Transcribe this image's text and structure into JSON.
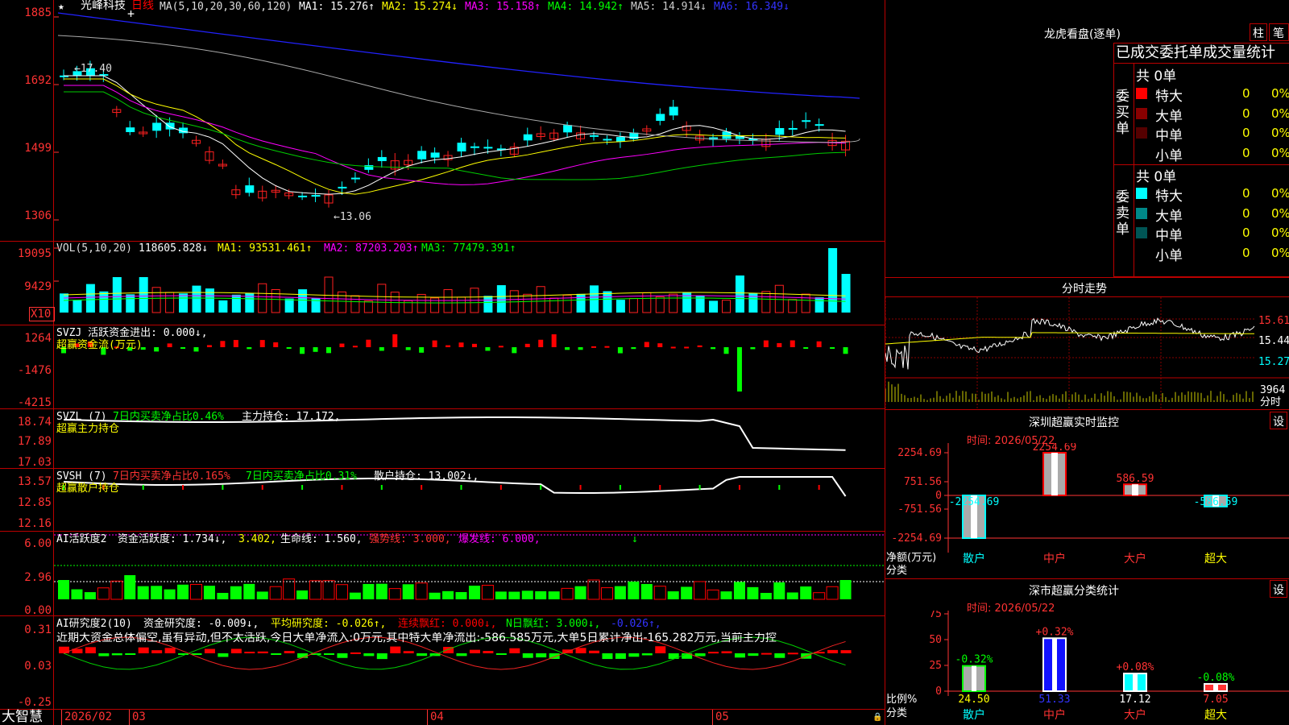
{
  "main": {
    "yticks": [
      "1885",
      "1692",
      "1499",
      "1306"
    ],
    "title": "光峰科技",
    "period": "日线",
    "ma_head": "MA(5,10,20,30,60,120)",
    "mas": [
      {
        "label": "MA1: 15.276↑",
        "color": "#ffffff"
      },
      {
        "label": "MA2: 15.274↓",
        "color": "#ffff00"
      },
      {
        "label": "MA3: 15.158↑",
        "color": "#ff00ff"
      },
      {
        "label": "MA4: 14.942↑",
        "color": "#00ff00"
      },
      {
        "label": "MA5: 14.914↓",
        "color": "#cccccc"
      },
      {
        "label": "MA6: 16.349↓",
        "color": "#3333ff"
      }
    ],
    "high_note": "←17.40",
    "low_note": "←13.06",
    "star": "★",
    "cursor": "+"
  },
  "vol": {
    "yticks": [
      "19095",
      "9429"
    ],
    "unit": "X10",
    "head": "VOL(5,10,20)",
    "items": [
      {
        "label": "118605.828↓",
        "color": "#ffffff"
      },
      {
        "label": "MA1: 93531.461↑",
        "color": "#ffff00"
      },
      {
        "label": "MA2: 87203.203↑",
        "color": "#ff00ff"
      },
      {
        "label": "MA3: 77479.391↑",
        "color": "#00ff00"
      }
    ]
  },
  "svzj": {
    "yticks": [
      "1264",
      "-1476",
      "-4215"
    ],
    "line1": "SVZJ  活跃资金进出: 0.000↓,",
    "line2": "超赢资金流(万元)"
  },
  "svzl": {
    "yticks": [
      "18.74",
      "17.89",
      "17.03"
    ],
    "a": "SVZL (7)",
    "b": "7日内买卖净占比0.46%",
    "c": "主力持仓: 17.172,",
    "line2": "超赢主力持仓"
  },
  "svsh": {
    "yticks": [
      "13.57",
      "12.85",
      "12.16"
    ],
    "a": "SVSH (7)",
    "b": "7日内买卖净占比0.165%",
    "c": "7日内买卖净占比0.31%",
    "d": "散户持仓: 13.002↓,",
    "line2": "超赢散户持仓"
  },
  "ai": {
    "yticks": [
      "6.00",
      "2.96",
      "0.00"
    ],
    "a": "AI活跃度2",
    "b": "资金活跃度: 1.734↓,",
    "c": "3.402,",
    "d": "生命线: 1.560,",
    "e": "强势线: 3.000,",
    "f": "爆发线: 6.000,",
    "arrow": "↓"
  },
  "research": {
    "yticks": [
      "0.31",
      "0.03",
      "-0.25"
    ],
    "a": "AI研究度2(10)",
    "b": "资金研究度: -0.009↓,",
    "c": "平均研究度: -0.026↑,",
    "d": "连续飘红: 0.000↓,",
    "e": "N日飘红: 3.000↓,",
    "f": "-0.026↑,",
    "note": "近期大资金总体偏空,虽有异动,但不太活跃,今日大单净流入:0万元,其中特大单净流出:-586.585万元,大单5日累计净出-165.282万元,当前主力控"
  },
  "bottom": {
    "brand": "大智慧",
    "dates": [
      "2026/02",
      "03",
      "04",
      "05"
    ],
    "lock": "🔒"
  },
  "right": {
    "dragon_title": "龙虎看盘(逐单)",
    "btn_zhu": "柱",
    "btn_bi": "笔",
    "stats_header": "已成交委托单成交量统计",
    "buy_label": "委买单",
    "sell_label": "委卖单",
    "buy_total": "共 0单",
    "sell_total": "共 0单",
    "buy_rows": [
      {
        "name": "特大",
        "val": "0",
        "pct": "0%",
        "color": "#ff0000"
      },
      {
        "name": "大单",
        "val": "0",
        "pct": "0%",
        "color": "#880000"
      },
      {
        "name": "中单",
        "val": "0",
        "pct": "0%",
        "color": "#550000"
      },
      {
        "name": "小单",
        "val": "0",
        "pct": "0%",
        "color": ""
      }
    ],
    "sell_rows": [
      {
        "name": "特大",
        "val": "0",
        "pct": "0%",
        "color": "#00ffff"
      },
      {
        "name": "大单",
        "val": "0",
        "pct": "0%",
        "color": "#008888"
      },
      {
        "name": "中单",
        "val": "0",
        "pct": "0%",
        "color": "#005555"
      },
      {
        "name": "小单",
        "val": "0",
        "pct": "0%",
        "color": ""
      }
    ],
    "intraday_title": "分时走势",
    "intraday_y": [
      "15.61",
      "15.44",
      "15.27"
    ],
    "intraday_vol": "3964",
    "intraday_vol_unit": "分时",
    "monitor_title": "深圳超赢实时监控",
    "settings": "设",
    "date_label": "时间: 2026/05/22",
    "monitor_y": [
      "2254.69",
      "751.56",
      "0",
      "-751.56",
      "-2254.69"
    ],
    "monitor_axis": "净额(万元)",
    "monitor_axis2": "分类",
    "monitor_bars": [
      {
        "cat": "散户",
        "value": -2254.69,
        "label": "-2254.69"
      },
      {
        "cat": "中户",
        "value": 2254.69,
        "label": "2254.69"
      },
      {
        "cat": "大户",
        "value": 586.59,
        "label": "586.59"
      },
      {
        "cat": "超大",
        "value": -586.59,
        "label": "-586.59"
      }
    ],
    "class_title": "深市超赢分类统计",
    "class_y": [
      "75",
      "50",
      "25",
      "0"
    ],
    "class_axis": "比例%",
    "class_axis2": "分类",
    "class_bars": [
      {
        "cat": "散户",
        "value": 24.5,
        "label": "24.50",
        "change": "-0.32%"
      },
      {
        "cat": "中户",
        "value": 51.33,
        "label": "51.33",
        "change": "+0.32%"
      },
      {
        "cat": "大户",
        "value": 17.12,
        "label": "17.12",
        "change": "+0.08%"
      },
      {
        "cat": "超大",
        "value": 7.05,
        "label": "7.05",
        "change": "-0.08%"
      }
    ]
  }
}
